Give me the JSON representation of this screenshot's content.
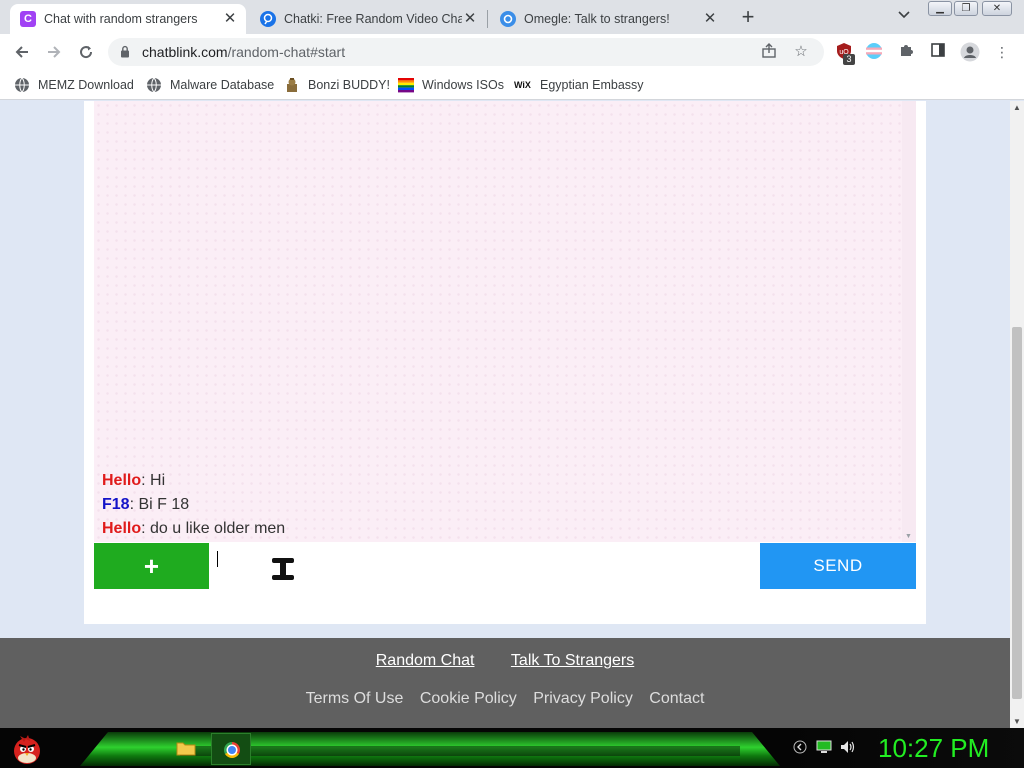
{
  "browser": {
    "tabs": [
      {
        "title": "Chat with random strangers",
        "favicon_letter": "C",
        "favicon_color": "#a142f4",
        "active": true
      },
      {
        "title": "Chatki: Free Random Video Chat",
        "favicon_letter": "",
        "favicon_color": "#1a73e8",
        "active": false
      },
      {
        "title": "Omegle: Talk to strangers!",
        "favicon_letter": "",
        "favicon_color": "#3b8ee8",
        "active": false
      }
    ],
    "url_host": "chatblink.com",
    "url_path": "/random-chat#start",
    "extension_badge": "3",
    "bookmarks": [
      {
        "label": "MEMZ Download",
        "icon": "globe-icon"
      },
      {
        "label": "Malware Database",
        "icon": "globe-icon"
      },
      {
        "label": "Bonzi BUDDY!",
        "icon": "bonzi-icon"
      },
      {
        "label": "Windows ISOs",
        "icon": "rainbow-flag-icon"
      },
      {
        "label": "Egyptian Embassy",
        "icon": "wix-icon"
      }
    ]
  },
  "chat": {
    "messages": [
      {
        "nick": "Hello",
        "nick_color": "#e01b1b",
        "text": ": Hi"
      },
      {
        "nick": "F18",
        "nick_color": "#1414c8",
        "text": ": Bi F 18"
      },
      {
        "nick": "Hello",
        "nick_color": "#e01b1b",
        "text": ": do u like older men"
      }
    ],
    "plus_label": "+",
    "input_value": "",
    "send_label": "SEND"
  },
  "footer": {
    "links": [
      "Random Chat",
      "Talk To Strangers"
    ],
    "legal": [
      "Terms Of Use",
      "Cookie Policy",
      "Privacy Policy",
      "Contact"
    ]
  },
  "taskbar": {
    "clock": "10:27 PM",
    "accent_color": "#22ee22"
  }
}
